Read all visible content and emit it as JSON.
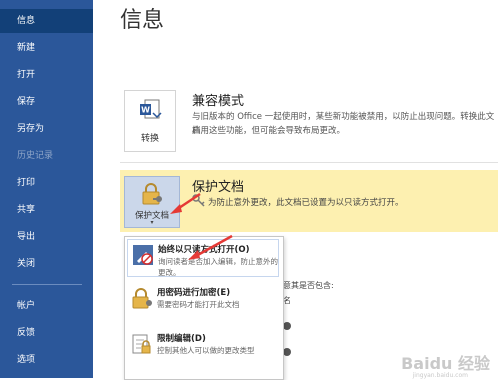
{
  "sidebar": {
    "items": [
      {
        "label": "信息",
        "active": true
      },
      {
        "label": "新建"
      },
      {
        "label": "打开"
      },
      {
        "label": "保存"
      },
      {
        "label": "另存为"
      },
      {
        "label": "历史记录",
        "disabled": true
      },
      {
        "label": "打印"
      },
      {
        "label": "共享"
      },
      {
        "label": "导出"
      },
      {
        "label": "关闭"
      },
      {
        "label": "帐户"
      },
      {
        "label": "反馈"
      },
      {
        "label": "选项"
      }
    ]
  },
  "main": {
    "title": "信息",
    "compat": {
      "button_label": "转换",
      "title": "兼容模式",
      "desc_line1": "与旧版本的 Office 一起使用时，某些新功能被禁用，以防止出现问题。转换此文档",
      "desc_line2": "启用这些功能，但可能会导致布局更改。"
    },
    "protect": {
      "button_label": "保护文档",
      "title": "保护文档",
      "status": "为防止意外更改，此文档已设置为以只读方式打开。"
    },
    "background": {
      "line1": "意其是否包含:",
      "line2": "名"
    }
  },
  "dropdown": {
    "items": [
      {
        "title": "始终以只读方式打开(O)",
        "desc": "询问读者是否加入编辑，防止意外的更改。",
        "icon": "pencil-no-edit-icon"
      },
      {
        "title": "用密码进行加密(E)",
        "desc": "需要密码才能打开此文档",
        "icon": "lock-key-icon"
      },
      {
        "title": "限制编辑(D)",
        "desc": "控制其他人可以做的更改类型",
        "icon": "restrict-edit-icon"
      }
    ]
  },
  "watermark": {
    "text": "Baidu 经验",
    "sub": "jingyan.baidu.com"
  },
  "colors": {
    "sidebar": "#2b579a",
    "sidebar_active": "#124078",
    "protect_bg": "#fdf0b0",
    "arrow": "#e53935"
  }
}
